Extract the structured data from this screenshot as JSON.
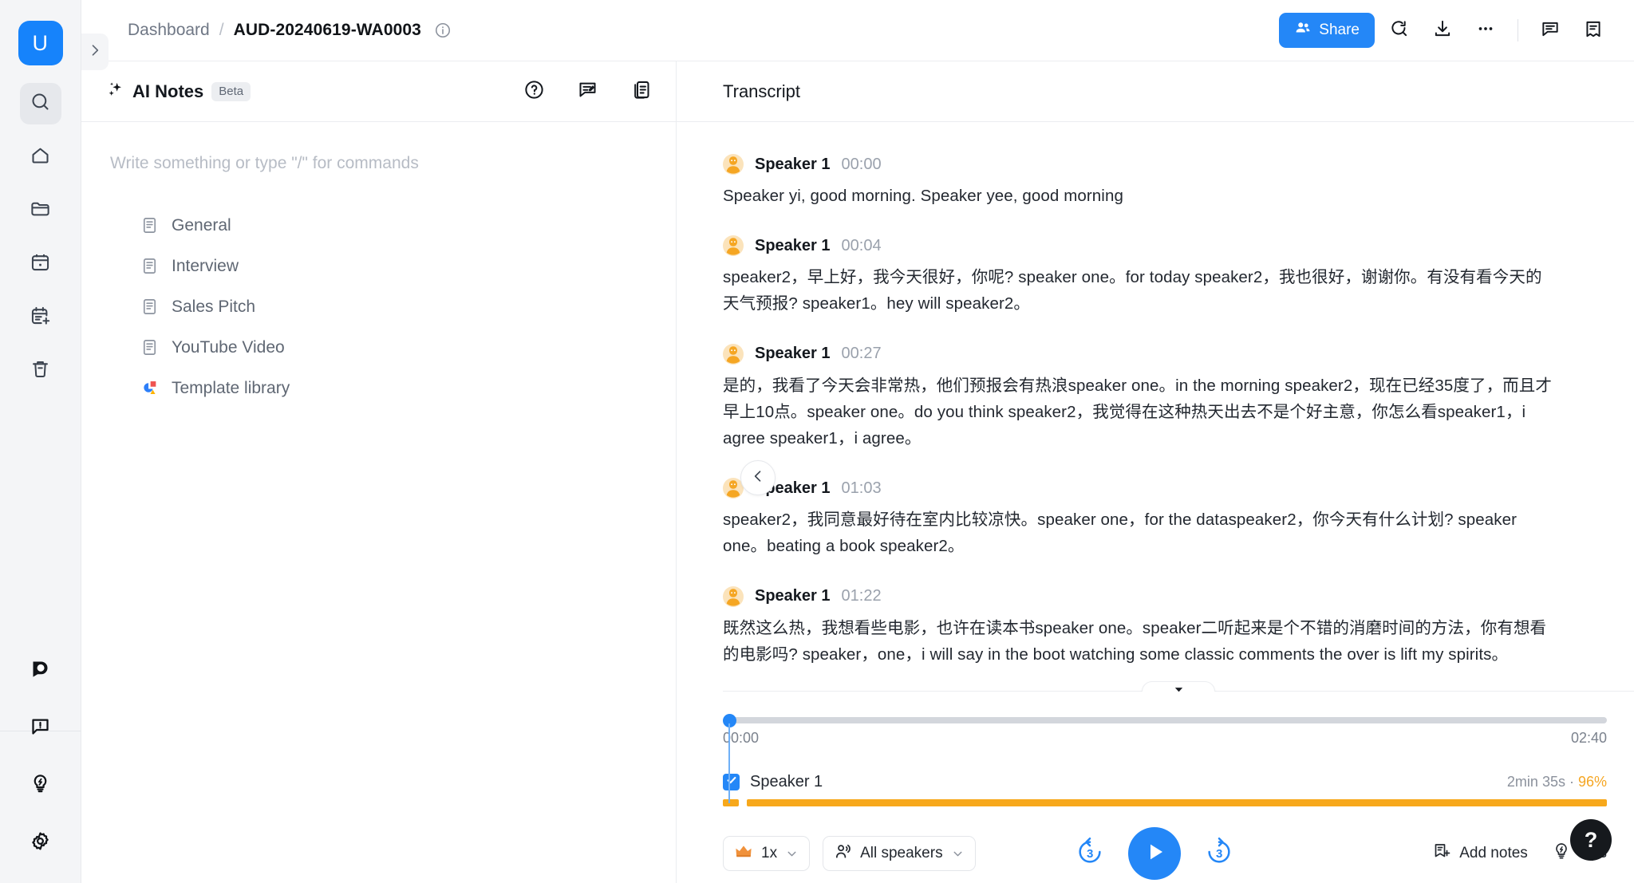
{
  "app": {
    "logo_letter": "U"
  },
  "rail": {
    "items": [
      {
        "name": "search",
        "icon": "search-icon",
        "active": true
      },
      {
        "name": "home",
        "icon": "home-icon",
        "active": false
      },
      {
        "name": "folder",
        "icon": "folder-icon",
        "active": false
      },
      {
        "name": "calendar",
        "icon": "calendar-icon",
        "active": false
      },
      {
        "name": "calendar-add",
        "icon": "calendar-add-icon",
        "active": false
      },
      {
        "name": "trash",
        "icon": "trash-icon",
        "active": false
      }
    ],
    "bottom_items": [
      {
        "name": "brand",
        "icon": "shield-logo-icon"
      },
      {
        "name": "feedback",
        "icon": "feedback-icon"
      },
      {
        "name": "tips",
        "icon": "bulb-icon"
      },
      {
        "name": "settings",
        "icon": "gear-icon"
      }
    ]
  },
  "header": {
    "breadcrumb_root": "Dashboard",
    "breadcrumb_separator": "/",
    "breadcrumb_current": "AUD-20240619-WA0003",
    "info_icon": "info-icon",
    "share_label": "Share",
    "actions": [
      {
        "name": "search-refresh",
        "icon": "search-refresh-icon"
      },
      {
        "name": "download",
        "icon": "download-icon"
      },
      {
        "name": "more",
        "icon": "more-horizontal-icon"
      },
      {
        "name": "comment",
        "icon": "comment-icon"
      },
      {
        "name": "notes-panel",
        "icon": "notes-panel-icon"
      }
    ]
  },
  "notes": {
    "title": "AI Notes",
    "badge": "Beta",
    "placeholder": "Write something or type \"/\" for commands",
    "head_actions": [
      {
        "name": "help",
        "icon": "question-circle-icon"
      },
      {
        "name": "feedback",
        "icon": "comment-edit-icon"
      },
      {
        "name": "duplicate",
        "icon": "copy-icon"
      }
    ],
    "templates": [
      {
        "label": "General",
        "icon": "document-icon"
      },
      {
        "label": "Interview",
        "icon": "document-icon"
      },
      {
        "label": "Sales Pitch",
        "icon": "document-icon"
      },
      {
        "label": "YouTube Video",
        "icon": "document-icon"
      },
      {
        "label": "Template library",
        "icon": "template-library-icon"
      }
    ]
  },
  "collapse_button": {
    "icon": "chevron-left-icon"
  },
  "transcript": {
    "title": "Transcript",
    "scroll_down_icon": "chevron-down-icon",
    "entries": [
      {
        "speaker": "Speaker 1",
        "time": "00:00",
        "text": "Speaker yi, good morning. Speaker yee, good morning"
      },
      {
        "speaker": "Speaker 1",
        "time": "00:04",
        "text": "speaker2，早上好，我今天很好，你呢? speaker one。for today speaker2，我也很好，谢谢你。有没有看今天的天气预报? speaker1。hey will speaker2。"
      },
      {
        "speaker": "Speaker 1",
        "time": "00:27",
        "text": "是的，我看了今天会非常热，他们预报会有热浪speaker one。in the morning speaker2，现在已经35度了，而且才早上10点。speaker one。do you think speaker2，我觉得在这种热天出去不是个好主意，你怎么看speaker1，i agree speaker1，i agree。"
      },
      {
        "speaker": "Speaker 1",
        "time": "01:03",
        "text": "speaker2，我同意最好待在室内比较凉快。speaker one，for the dataspeaker2，你今天有什么计划? speaker one。beating a book speaker2。"
      },
      {
        "speaker": "Speaker 1",
        "time": "01:22",
        "text": "既然这么热，我想看些电影，也许在读本书speaker one。speaker二听起来是个不错的消磨时间的方法，你有想看的电影吗? speaker，one，i will say in the boot watching some classic comments the over is lift my spirits。"
      }
    ]
  },
  "player": {
    "current_time": "00:00",
    "total_time": "02:40",
    "speaker_track": {
      "label": "Speaker 1",
      "duration": "2min 35s",
      "separator": " · ",
      "percent": "96%",
      "checked": true
    },
    "speed_label": "1x",
    "speed_icon": "crown-icon",
    "speakers_label": "All speakers",
    "speakers_icon": "speakers-icon",
    "rewind_label": "3",
    "forward_label": "3",
    "play_icon": "play-icon",
    "add_notes_label": "Add notes",
    "add_notes_icon": "add-notes-icon",
    "tips_label": "Tips",
    "tips_icon": "bulb-icon",
    "chevron_icon": "chevron-down-icon"
  },
  "help_fab": {
    "label": "?"
  },
  "colors": {
    "brand_blue": "#2487f7",
    "logo_blue": "#1683fb",
    "accent_orange": "#f7a81b",
    "percent_orange": "#f5a623",
    "rail_bg": "#f4f5f7"
  }
}
